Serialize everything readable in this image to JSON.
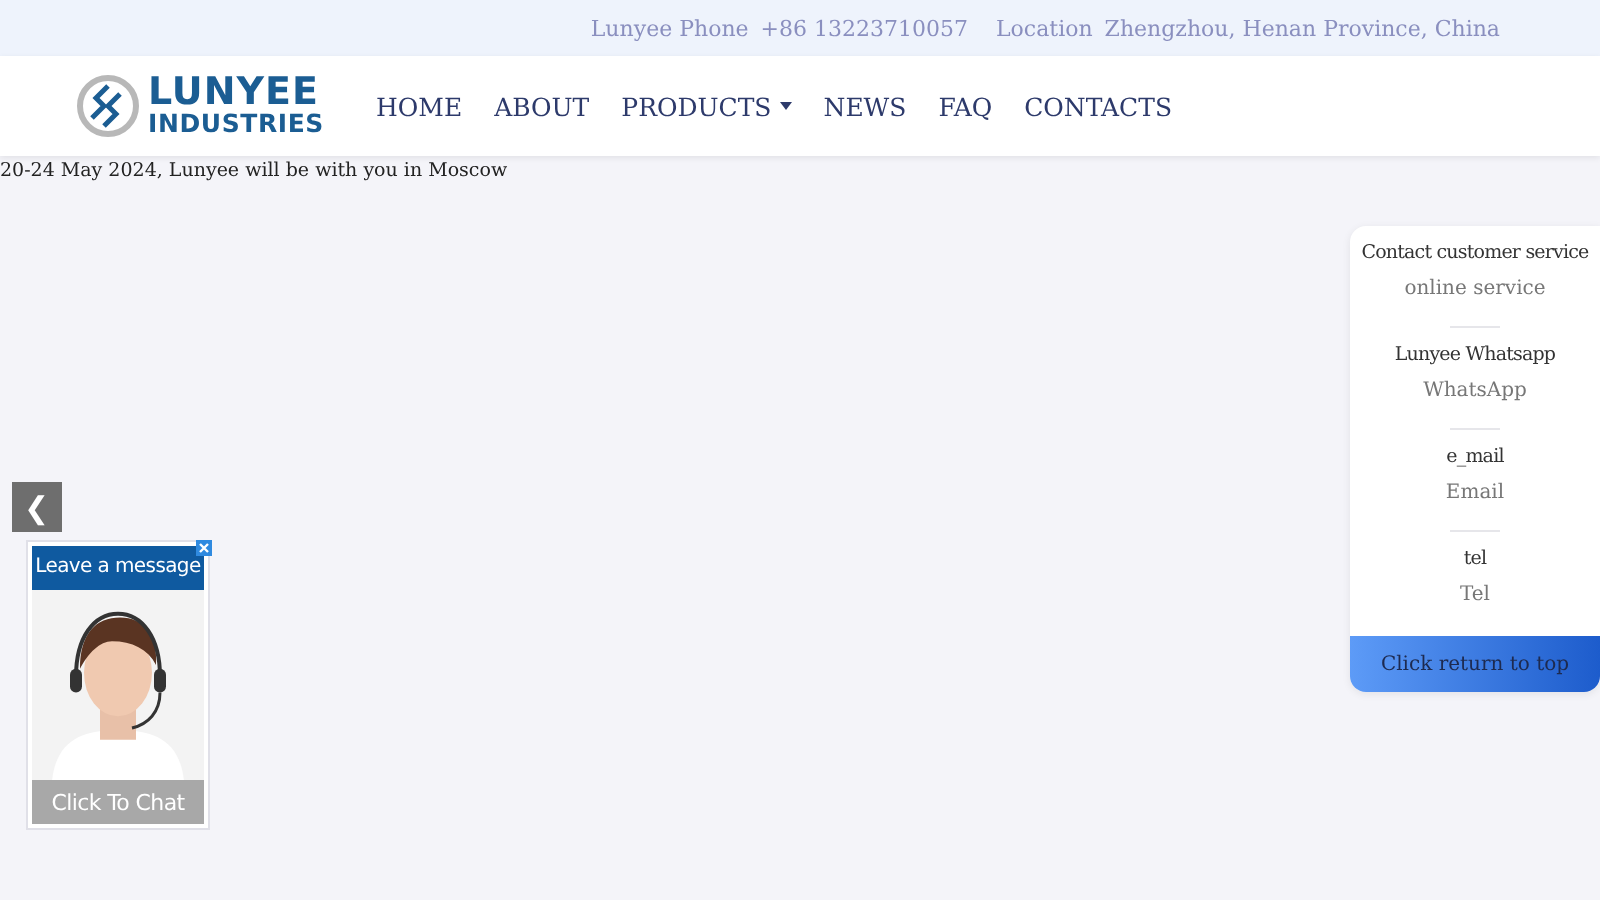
{
  "top_bar": {
    "phone_label": "Lunyee Phone",
    "phone": "+86 13223710057",
    "location_label": "Location",
    "location": "Zhengzhou, Henan Province, China"
  },
  "logo": {
    "line_1": "LUNYEE",
    "line_2": "INDUSTRIES"
  },
  "nav": [
    {
      "label": "HOME",
      "dropdown": false
    },
    {
      "label": "ABOUT",
      "dropdown": false
    },
    {
      "label": "PRODUCTS",
      "dropdown": true
    },
    {
      "label": "NEWS",
      "dropdown": false
    },
    {
      "label": "FAQ",
      "dropdown": false
    },
    {
      "label": "CONTACTS",
      "dropdown": false
    }
  ],
  "announcement": "20-24 May 2024, Lunyee will be with you in Moscow",
  "slider_prev": "❮",
  "chat_widget": {
    "header": "Leave a message",
    "button": "Click To Chat"
  },
  "contact_panel": {
    "items": [
      {
        "title": "Contact customer service",
        "subtitle": "online service"
      },
      {
        "title": "Lunyee Whatsapp",
        "subtitle": "WhatsApp"
      },
      {
        "title": "e_mail",
        "subtitle": "Email"
      },
      {
        "title": "tel",
        "subtitle": "Tel"
      }
    ],
    "back_to_top": "Click return to top"
  }
}
